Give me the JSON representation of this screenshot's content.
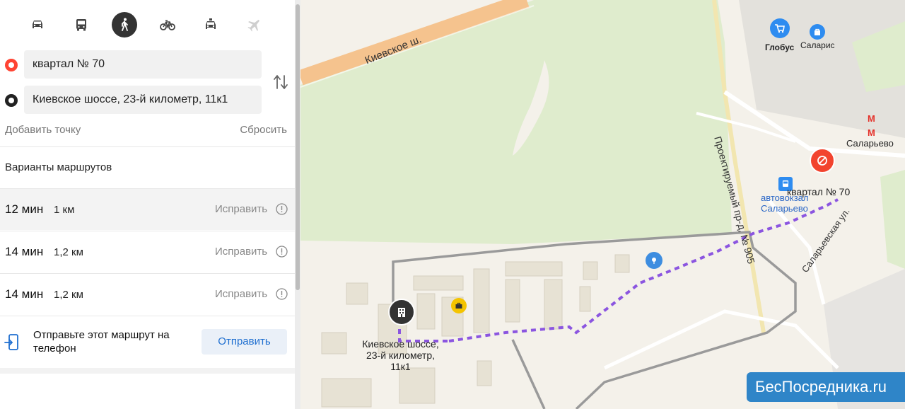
{
  "transport_modes": [
    {
      "name": "car",
      "icon": "car-icon",
      "active": false
    },
    {
      "name": "bus",
      "icon": "bus-icon",
      "active": false
    },
    {
      "name": "pedestrian",
      "icon": "pedestrian-icon",
      "active": true
    },
    {
      "name": "bicycle",
      "icon": "bicycle-icon",
      "active": false
    },
    {
      "name": "taxi",
      "icon": "taxi-icon",
      "active": false
    },
    {
      "name": "plane",
      "icon": "plane-icon",
      "active": false
    }
  ],
  "route_form": {
    "point_a": "квартал № 70",
    "point_b": "Киевское шоссе, 23-й километр, 11к1",
    "add_point_label": "Добавить точку",
    "reset_label": "Сбросить"
  },
  "variants_title": "Варианты маршрутов",
  "routes": [
    {
      "time": "12 мин",
      "distance": "1 км",
      "fix_label": "Исправить",
      "selected": true
    },
    {
      "time": "14 мин",
      "distance": "1,2 км",
      "fix_label": "Исправить",
      "selected": false
    },
    {
      "time": "14 мин",
      "distance": "1,2 км",
      "fix_label": "Исправить",
      "selected": false
    }
  ],
  "send_to_phone": {
    "text": "Отправьте этот маршрут на телефон",
    "button_label": "Отправить"
  },
  "map": {
    "road_kievskoe": "Киевское ш.",
    "road_proektiruemy": "Проектируемый пр-д, № 905",
    "road_salarevskaya": "Саларьевская ул.",
    "poi_globus": "Глобус",
    "poi_salaris": "Саларис",
    "metro_salarevo": "Саларьево",
    "bus_station": "автовокзал Саларьево",
    "destination_label": "квартал № 70",
    "origin_label_line1": "Киевское шоссе,",
    "origin_label_line2": "23-й километр, 11к1",
    "watermark": "БесПосредника.ru",
    "colors": {
      "route_primary": "#8b55e0",
      "route_alt": "#9a9a9a",
      "destination_pin": "#f2442e",
      "highway": "#f5c38e"
    }
  }
}
